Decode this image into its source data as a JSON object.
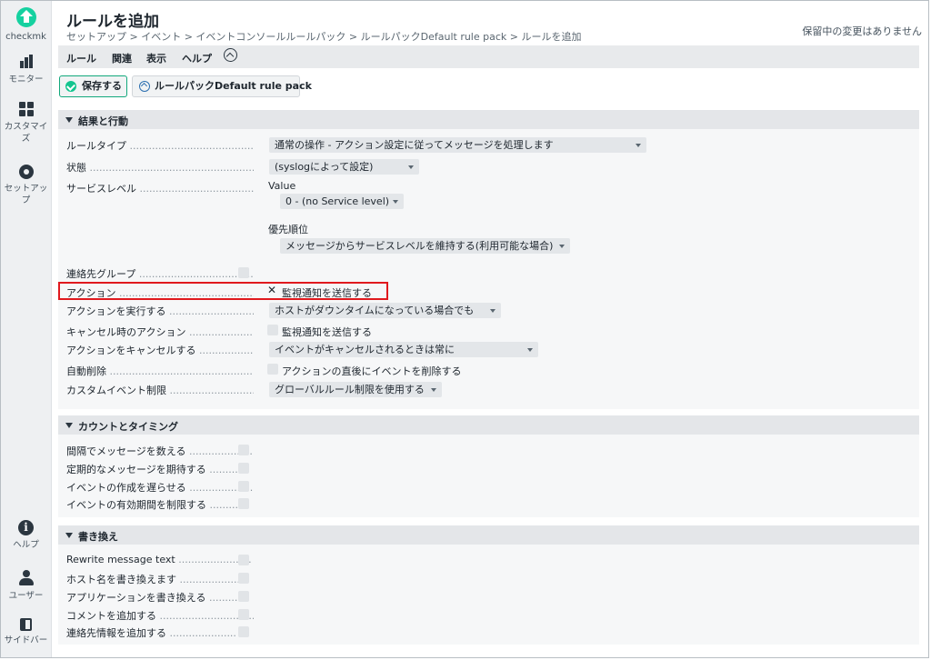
{
  "sidebar": {
    "logo_text": "checkmk",
    "items": [
      {
        "label": "モニター",
        "icon": "monitor-bars-icon"
      },
      {
        "label": "カスタマイズ",
        "icon": "customize-grid-icon"
      },
      {
        "label": "セットアップ",
        "icon": "gear-icon"
      },
      {
        "label": "ヘルプ",
        "icon": "help-icon"
      },
      {
        "label": "ユーザー",
        "icon": "user-icon"
      },
      {
        "label": "サイドバー",
        "icon": "sidebar-icon"
      }
    ]
  },
  "header": {
    "title": "ルールを追加",
    "breadcrumb": "セットアップ > イベント > イベントコンソールルールパック > ルールパックDefault rule pack > ルールを追加",
    "pending": "保留中の変更はありません"
  },
  "menu": {
    "items": [
      "ルール",
      "関連",
      "表示",
      "ヘルプ"
    ]
  },
  "toolbar": {
    "save_label": "保存する",
    "pack_label": "ルールパックDefault rule pack"
  },
  "sections": {
    "result": {
      "title": "結果と行動",
      "rule_type_label": "ルールタイプ",
      "rule_type_value": "通常の操作 - アクション設定に従ってメッセージを処理します",
      "state_label": "状態",
      "state_value": "(syslogによって設定)",
      "service_level_label": "サービスレベル",
      "value_sublabel": "Value",
      "service_level_value": "0 - (no Service level)",
      "priority_sublabel": "優先順位",
      "priority_value": "メッセージからサービスレベルを維持する(利用可能な場合)",
      "contact_group_label": "連絡先グループ",
      "action_label": "アクション",
      "action_value": "監視通知を送信する",
      "run_action_label": "アクションを実行する",
      "run_action_value": "ホストがダウンタイムになっている場合でも",
      "cancel_action_label": "キャンセル時のアクション",
      "cancel_action_value": "監視通知を送信する",
      "cancel_actions_label": "アクションをキャンセルする",
      "cancel_actions_value": "イベントがキャンセルされるときは常に",
      "auto_delete_label": "自動削除",
      "auto_delete_value": "アクションの直後にイベントを削除する",
      "custom_limit_label": "カスタムイベント制限",
      "custom_limit_value": "グローバルルール制限を使用する"
    },
    "timing": {
      "title": "カウントとタイミング",
      "rows": [
        "間隔でメッセージを数える",
        "定期的なメッセージを期待する",
        "イベントの作成を遅らせる",
        "イベントの有効期間を制限する"
      ]
    },
    "rewrite": {
      "title": "書き換え",
      "rows": [
        "Rewrite message text",
        "ホスト名を書き換えます",
        "アプリケーションを書き換える",
        "コメントを追加する",
        "連絡先情報を追加する"
      ]
    }
  },
  "colors": {
    "accent": "#15d1a0",
    "highlight": "#e0191e"
  }
}
